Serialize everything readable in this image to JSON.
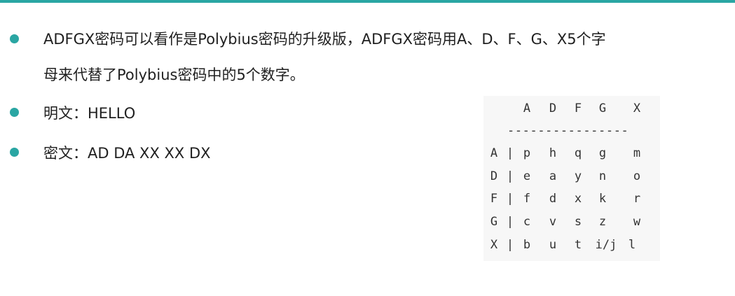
{
  "theme": {
    "accent": "#2aa6a3",
    "text": "#1f1f1f"
  },
  "bullets": [
    {
      "line1": "ADFGX密码可以看作是Polybius密码的升级版，ADFGX密码用A、D、F、G、X5个字",
      "line2": "母来代替了Polybius密码中的5个数字。"
    },
    {
      "line1": "明文：HELLO"
    },
    {
      "line1": "密文：AD DA XX XX DX"
    }
  ],
  "matrix": {
    "col_headers": [
      "A",
      "D",
      "F",
      "G",
      "X"
    ],
    "rule": "----------------",
    "rows": [
      {
        "label": "A",
        "sep": "|",
        "cells": [
          "p",
          "h",
          "q",
          "g",
          "m"
        ]
      },
      {
        "label": "D",
        "sep": "|",
        "cells": [
          "e",
          "a",
          "y",
          "n",
          "o"
        ]
      },
      {
        "label": "F",
        "sep": "|",
        "cells": [
          "f",
          "d",
          "x",
          "k",
          "r"
        ]
      },
      {
        "label": "G",
        "sep": "|",
        "cells": [
          "c",
          "v",
          "s",
          "z",
          "w"
        ]
      },
      {
        "label": "X",
        "sep": "|",
        "cells": [
          "b",
          "u",
          "t",
          "i/j",
          "l"
        ]
      }
    ]
  }
}
